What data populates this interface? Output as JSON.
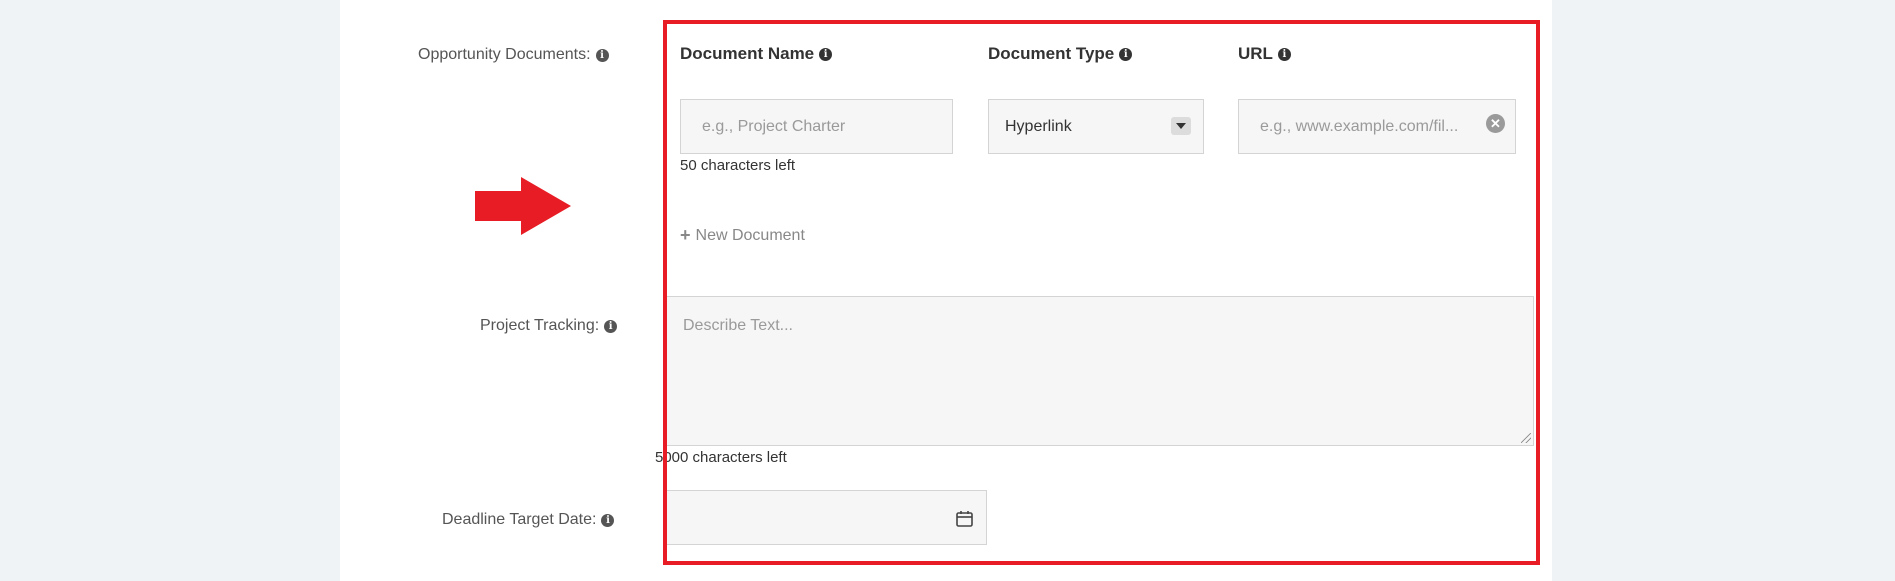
{
  "labels": {
    "opportunity_documents": "Opportunity Documents:",
    "project_tracking": "Project Tracking:",
    "deadline_target_date": "Deadline Target Date:"
  },
  "columns": {
    "document_name": "Document Name",
    "document_type": "Document Type",
    "url": "URL"
  },
  "document_row": {
    "name_placeholder": "e.g., Project Charter",
    "type_value": "Hyperlink",
    "url_placeholder": "e.g., www.example.com/fil..."
  },
  "name_chars_left": "50 characters left",
  "new_document_label": "New Document",
  "project_tracking": {
    "placeholder": "Describe Text...",
    "chars_left": "5000 characters left"
  },
  "icons": {
    "info": "info-circle-icon",
    "caret": "caret-down-icon",
    "clear": "close-circle-icon",
    "plus": "plus-icon",
    "calendar": "calendar-icon",
    "arrow": "right-arrow-annotation"
  },
  "colors": {
    "highlight": "#e81c24",
    "background": "#f0f3f6",
    "field_bg": "#f6f6f6"
  }
}
